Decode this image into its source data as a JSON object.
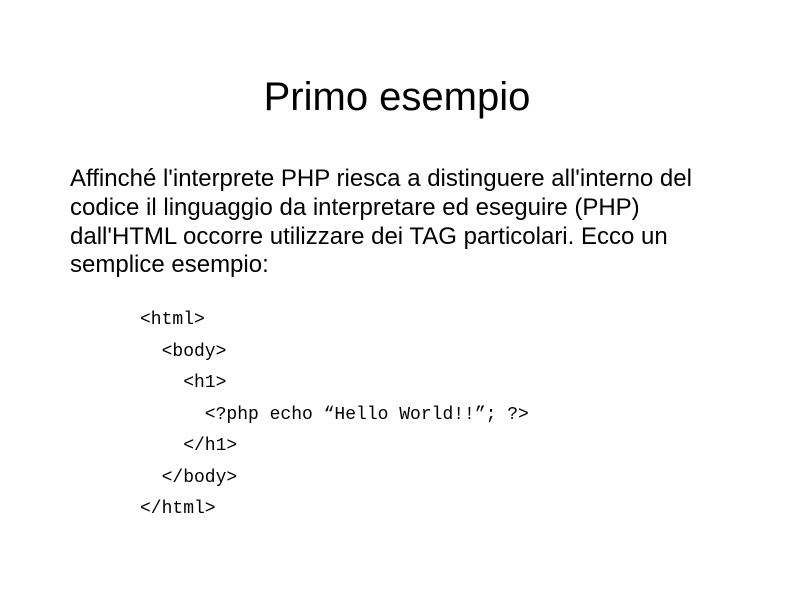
{
  "title": "Primo esempio",
  "paragraph": "Affinché l'interprete PHP riesca a distinguere all'interno del codice il linguaggio da interpretare ed eseguire (PHP) dall'HTML occorre utilizzare dei TAG particolari. Ecco un semplice esempio:",
  "code": {
    "l1": "<html>",
    "l2": "  <body>",
    "l3": "    <h1>",
    "l4": "      <?php echo “Hello World!!”; ?>",
    "l5": "    </h1>",
    "l6": "  </body>",
    "l7": "</html>"
  }
}
